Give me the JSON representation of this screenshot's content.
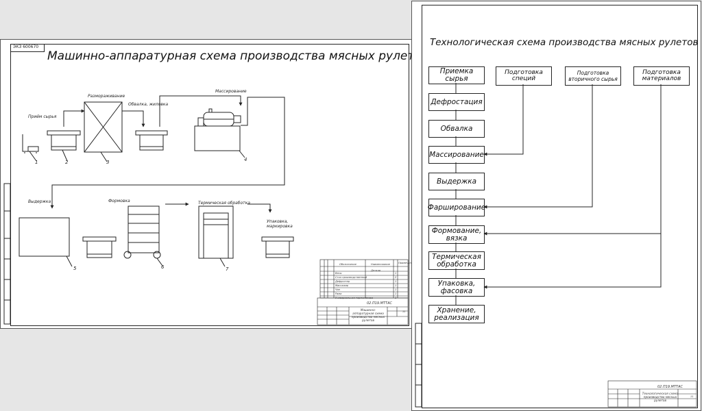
{
  "left_sheet": {
    "code": "ЭКЗ 600670",
    "title": "Машинно-аппаратурная схема производства мясных рулетов",
    "labels": {
      "priem": "Приём сырья",
      "razmorazhivanie": "Размораживание",
      "obvalka": "Обвалка, жиловка",
      "massirovanie": "Массирование",
      "vyderzhka": "Выдержка",
      "formovka": "Формовка",
      "termicheskaya": "Термическая обработка",
      "upakovka": "Упаковка, маркировка"
    },
    "numbers": [
      "1",
      "2",
      "3",
      "4",
      "5",
      "6",
      "7"
    ],
    "spec": {
      "col_oboz": "Обозначение",
      "col_naim": "Наименование",
      "col_kol": "Примечание",
      "section": "Детали",
      "rows": [
        {
          "name": "Весы",
          "n": "1"
        },
        {
          "name": "Стол производственный",
          "n": "2"
        },
        {
          "name": "Дефростер",
          "n": "1"
        },
        {
          "name": "Массажер",
          "n": "1"
        },
        {
          "name": "Чан",
          "n": "1"
        },
        {
          "name": "Рама",
          "n": "1"
        },
        {
          "name": "Универсальная термокамера",
          "n": "1"
        }
      ]
    },
    "stamp": {
      "doc": "02.П19.МТТАС",
      "name": "Машинно-аппаратурная схема производства мясных рулетов",
      "sheet": "11"
    }
  },
  "right_sheet": {
    "title": "Технологическая схема производства мясных рулетов",
    "steps": [
      "Приемка сырья",
      "Дефростация",
      "Обвалка",
      "Массирование",
      "Выдержка",
      "Фарширование",
      "Формование, вязка",
      "Термическая обработка",
      "Упаковка, фасовка",
      "Хранение, реализация"
    ],
    "side_boxes": [
      "Подготовка специй",
      "Подготовка вторичного сырья",
      "Подготовка материалов"
    ],
    "stamp": {
      "doc": "02.П19.МТТАС",
      "name": "Технологическая схема производства мясных рулетов",
      "sheet": "11"
    }
  }
}
